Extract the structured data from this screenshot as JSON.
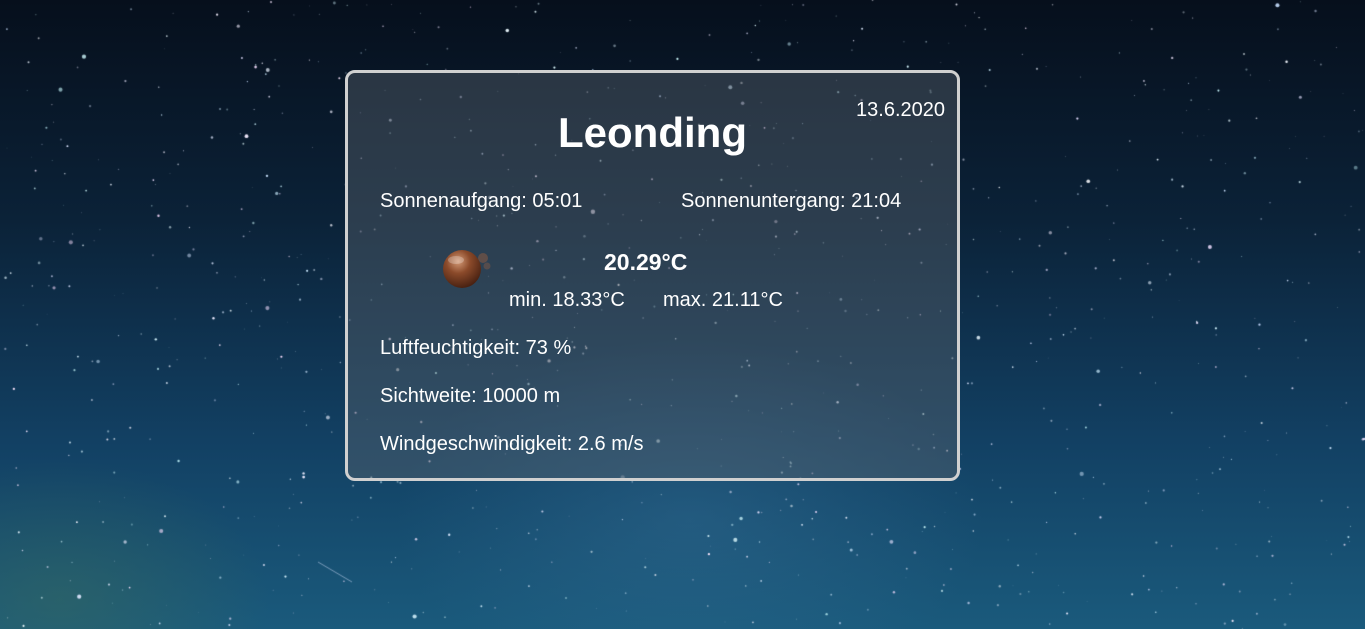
{
  "weather": {
    "date": "13.6.2020",
    "city": "Leonding",
    "sunrise": "Sonnenaufgang: 05:01",
    "sunset": "Sonnenuntergang: 21:04",
    "icon": "weather-condition-icon",
    "temperature": "20.29°C",
    "temp_min": "min. 18.33°C",
    "temp_max": "max. 21.11°C",
    "humidity": "Luftfeuchtigkeit: 73 %",
    "visibility": "Sichtweite: 10000 m",
    "wind": "Windgeschwindigkeit: 2.6 m/s"
  },
  "colors": {
    "card_border": "#d0d0d0",
    "text": "#ffffff",
    "icon_brown": "#7a3e22"
  }
}
